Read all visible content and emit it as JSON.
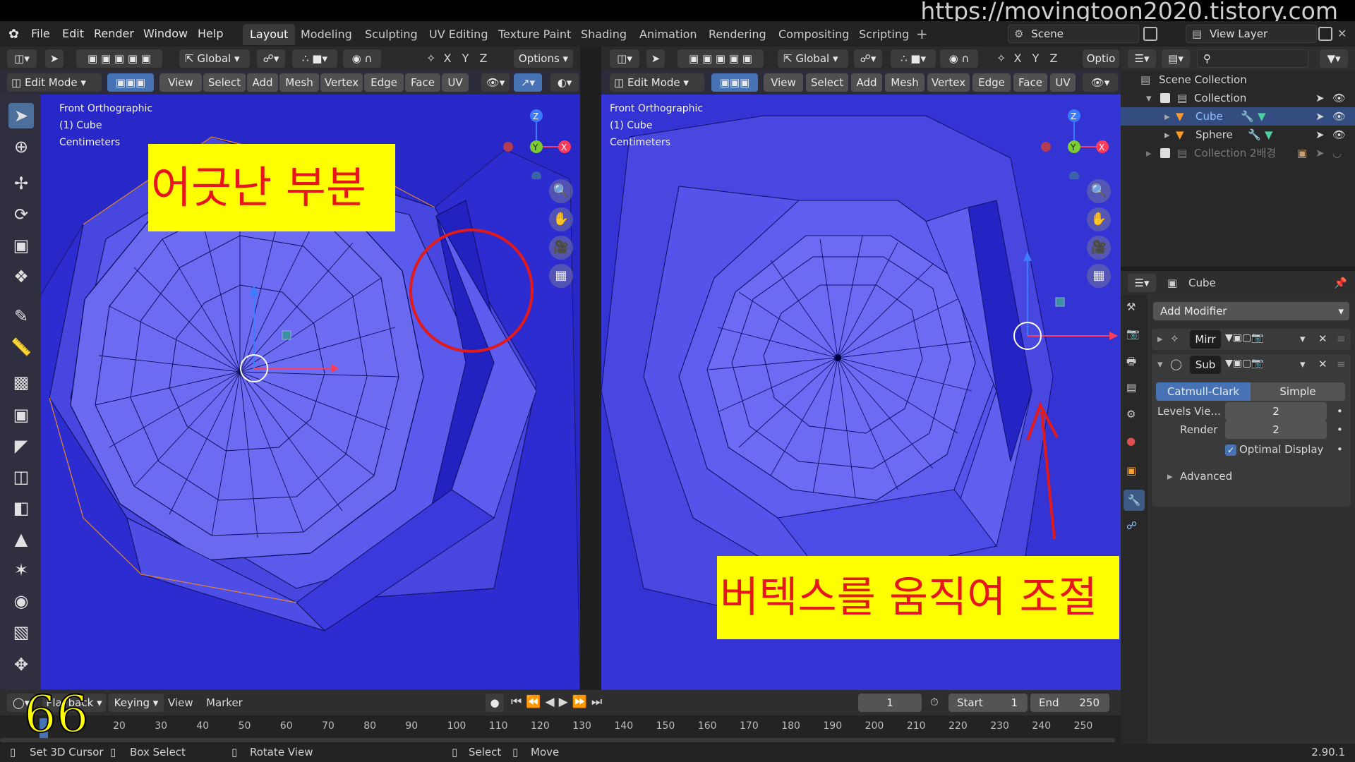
{
  "watermark": "https://movingtoon2020.tistory.com",
  "menu": [
    "File",
    "Edit",
    "Render",
    "Window",
    "Help"
  ],
  "workspace_tabs": [
    "Layout",
    "Modeling",
    "Sculpting",
    "UV Editing",
    "Texture Paint",
    "Shading",
    "Animation",
    "Rendering",
    "Compositing",
    "Scripting"
  ],
  "active_tab": "Layout",
  "scene": "Scene",
  "view_layer": "View Layer",
  "viewport_header": {
    "transform": "Global",
    "options": "Options",
    "options_short": "Optio",
    "mode": "Edit Mode",
    "menus": [
      "View",
      "Select",
      "Add",
      "Mesh",
      "Vertex",
      "Edge",
      "Face",
      "UV"
    ],
    "axes": [
      "X",
      "Y",
      "Z"
    ]
  },
  "viewport_left": {
    "view_name": "Front Orthographic",
    "object": "(1) Cube",
    "units": "Centimeters",
    "annotation": "어긋난 부분"
  },
  "viewport_right": {
    "view_name": "Front Orthographic",
    "object": "(1) Cube",
    "units": "Centimeters",
    "annotation": "버텍스를 움직여 조절"
  },
  "gizmo_axes": [
    "Z",
    "Y",
    "X"
  ],
  "outliner": {
    "title": "Scene Collection",
    "items": [
      {
        "label": "Collection",
        "indent": 1
      },
      {
        "label": "Cube",
        "indent": 2,
        "selected": true
      },
      {
        "label": "Sphere",
        "indent": 2
      },
      {
        "label": "Collection 2배경",
        "indent": 1,
        "disabled": true
      }
    ]
  },
  "properties": {
    "object_name": "Cube",
    "add_modifier": "Add Modifier",
    "modifiers": [
      {
        "name": "Mirr",
        "expanded": false
      },
      {
        "name": "Sub",
        "expanded": true
      }
    ],
    "subdiv_types": [
      "Catmull-Clark",
      "Simple"
    ],
    "active_subdiv": "Catmull-Clark",
    "levels_viewport_label": "Levels Vie...",
    "levels_viewport_value": "2",
    "render_label": "Render",
    "render_value": "2",
    "optimal_display": "Optimal Display",
    "advanced": "Advanced"
  },
  "timeline": {
    "playback": "Playback",
    "keying": "Keying",
    "view": "View",
    "marker": "Marker",
    "current_frame": "1",
    "start_label": "Start",
    "start": "1",
    "end_label": "End",
    "end": "250",
    "ruler": [
      "20",
      "30",
      "40",
      "50",
      "60",
      "70",
      "80",
      "90",
      "100",
      "110",
      "120",
      "130",
      "140",
      "150",
      "160",
      "170",
      "180",
      "190",
      "200",
      "210",
      "220",
      "230",
      "240",
      "250"
    ],
    "overlay_number": "66"
  },
  "statusbar": {
    "items": [
      "Set 3D Cursor",
      "Box Select",
      "Rotate View",
      "Select",
      "Move"
    ],
    "version": "2.90.1"
  },
  "colors": {
    "viewport_bg": "#2828c8",
    "mesh_face": "#5656e8",
    "annotation_bg": "#ffff00",
    "annotation_text": "#e8161a",
    "active_blue": "#4772b3"
  }
}
